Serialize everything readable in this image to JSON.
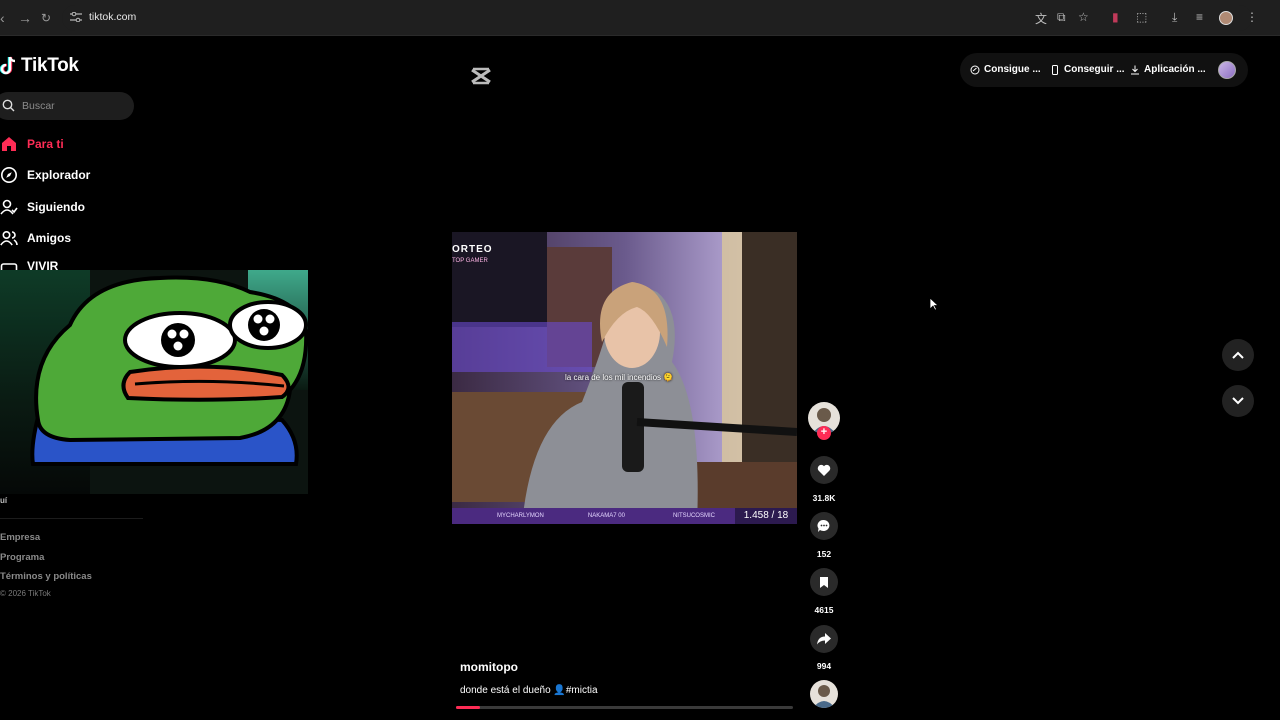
{
  "browser": {
    "url": "tiktok.com",
    "icons": [
      "back-icon",
      "forward-icon",
      "reload-icon",
      "site-settings-icon",
      "translate-icon",
      "cast-icon",
      "bookmark-star-icon",
      "extension-icon",
      "puzzle-icon",
      "download-icon",
      "reading-list-icon",
      "profile-avatar",
      "menu-dots-icon"
    ]
  },
  "sidebar": {
    "logo_text": "TikTok",
    "search_placeholder": "Buscar",
    "nav": [
      {
        "label": "Para ti",
        "icon": "home-icon",
        "active": true
      },
      {
        "label": "Explorador",
        "icon": "compass-icon",
        "active": false
      },
      {
        "label": "Siguiendo",
        "icon": "following-icon",
        "active": false
      },
      {
        "label": "Amigos",
        "icon": "friends-icon",
        "active": false
      },
      {
        "label": "VIVIR",
        "icon": "live-icon",
        "active": false
      }
    ],
    "partial_text": "uí",
    "footer": [
      "Empresa",
      "Programa",
      "Términos y políticas"
    ],
    "copyright": "© 2026 TikTok"
  },
  "topbar": {
    "pills": [
      {
        "label": "Consigue ...",
        "icon": "coin-icon"
      },
      {
        "label": "Conseguir ...",
        "icon": "phone-icon"
      },
      {
        "label": "Aplicación ...",
        "icon": "download-icon"
      }
    ]
  },
  "video": {
    "overlay_caption": "la cara de los mil incendios 🫠",
    "corner_title": "ORTEO",
    "corner_sub": "TOP GAMER",
    "ticker": [
      "MYCHARLYMON",
      "NAKAMA7 00",
      "NITSUCOSMIC"
    ],
    "counter": "1.458 / 18",
    "author": "momitopo",
    "description": "donde está el dueño 👤#mictia",
    "progress": 0.07
  },
  "actions": {
    "likes": "31.8K",
    "comments": "152",
    "saves": "4615",
    "shares": "994"
  },
  "colors": {
    "accent": "#fe2c55",
    "background": "#000000"
  }
}
